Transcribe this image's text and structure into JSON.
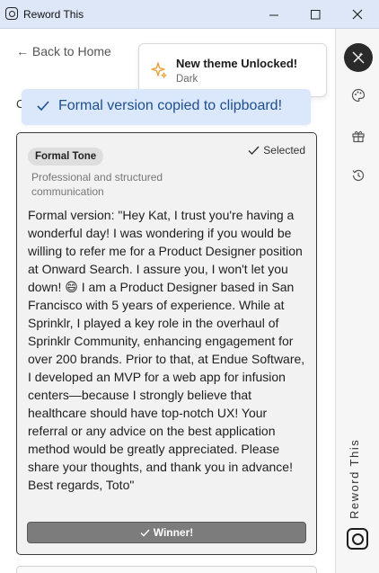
{
  "window": {
    "title": "Reword This"
  },
  "nav": {
    "back_label": "← Back to Home",
    "heading_partial": "C"
  },
  "theme_toast": {
    "title": "New theme Unlocked!",
    "subtitle": "Dark"
  },
  "copied_toast": {
    "message": "Formal version copied to clipboard!"
  },
  "card": {
    "badge": "Formal Tone",
    "selected_label": "Selected",
    "description": "Professional and structured communication",
    "body": "Formal version: \"Hey Kat, I trust you're having a wonderful day! I was wondering if you would be willing to refer me for a Product Designer position at Onward Search. I assure you, I won't let you down! 😄 I am a Product Designer based in San Francisco with 5 years of experience. While at Sprinklr, I played a key role in the overhaul of Sprinklr Community, enhancing engagement for over 200 brands. Prior to that, at Endue Software, I developed an MVP for a web app for infusion centers—because I strongly believe that healthcare should have top-notch UX! Your referral or any advice on the best application method would be greatly appreciated. Please share your thoughts, and thank you in advance! Best regards, Toto\"",
    "winner_label": "Winner!"
  },
  "sidebar": {
    "icons": [
      "magic-wand-off-icon",
      "palette-icon",
      "gift-icon",
      "history-icon"
    ],
    "brand_text": "Reword This"
  },
  "colors": {
    "titlebar": "#dde7f7",
    "toast_bg": "#dbe8fb",
    "toast_text": "#1d4f91",
    "sparkle": "#e8a33a",
    "winner_bg": "#7c7c7c"
  }
}
